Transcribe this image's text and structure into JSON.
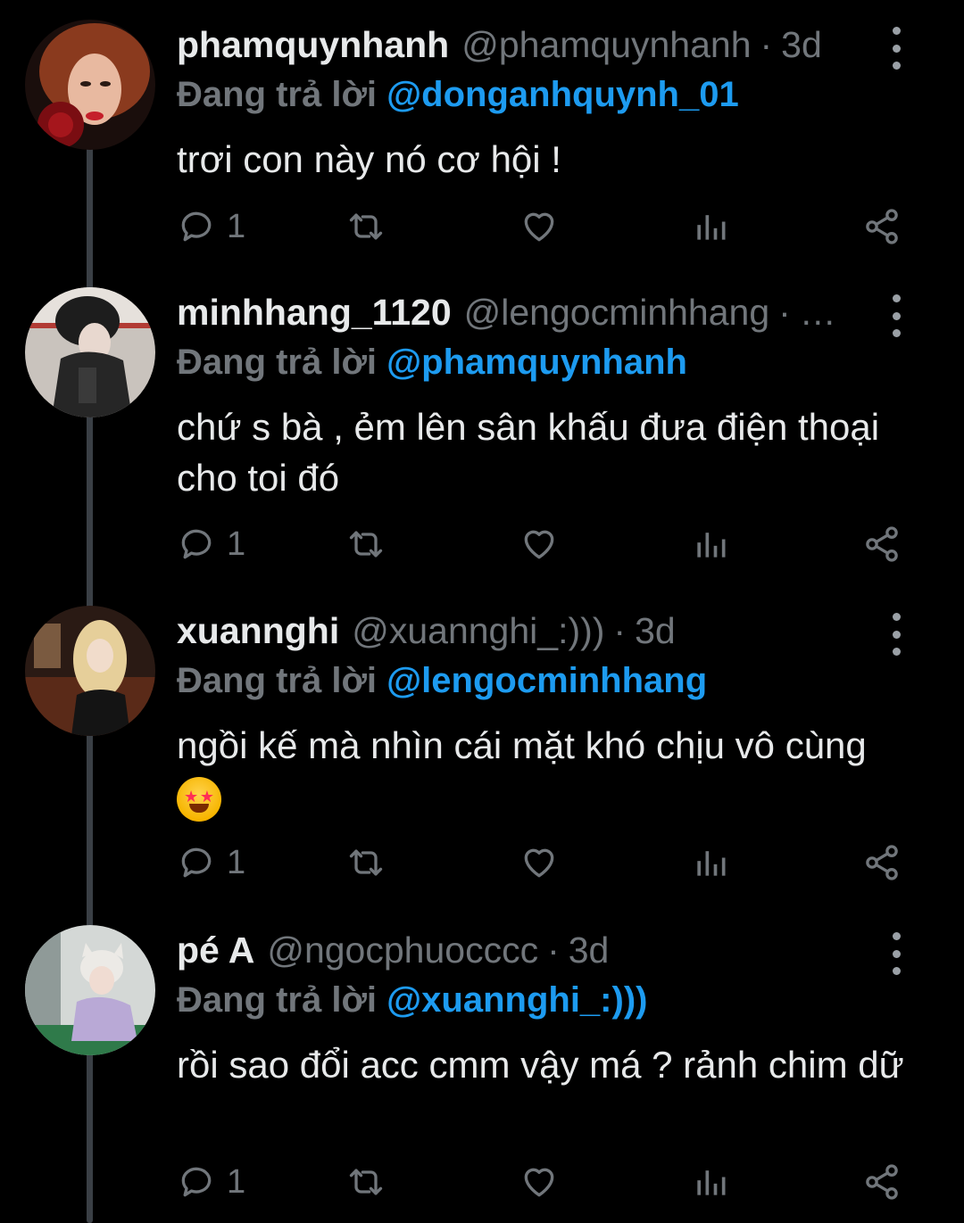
{
  "replying_label": "Đang trả lời",
  "tweets": [
    {
      "name": "phamquynhanh",
      "handle": "@phamquynhanh",
      "time": "3d",
      "replying_to": "@donganhquynh_01",
      "text": "trơi con này nó cơ hội !",
      "reply_count": "1"
    },
    {
      "name": "minhhang_1120",
      "handle": "@lengocminhhang",
      "time": "…",
      "replying_to": "@phamquynhanh",
      "text": "chứ s bà , ẻm lên sân khấu đưa điện thoại cho toi đó",
      "reply_count": "1"
    },
    {
      "name": "xuannghi",
      "handle": "@xuannghi_:)))",
      "time": "3d",
      "replying_to": "@lengocminhhang",
      "text": "ngồi kế mà nhìn cái mặt khó chịu vô cùng",
      "emoji": "star-struck",
      "reply_count": "1"
    },
    {
      "name": "pé A",
      "handle": "@ngocphuocccc",
      "time": "3d",
      "replying_to": "@xuannghi_:)))",
      "text": "rồi sao đổi acc cmm vậy má ? rảnh chim dữ",
      "reply_count": "1"
    }
  ],
  "colors": {
    "background": "#000000",
    "primary_text": "#e7e9ea",
    "secondary_text": "#71767b",
    "link": "#1d9bf0"
  }
}
